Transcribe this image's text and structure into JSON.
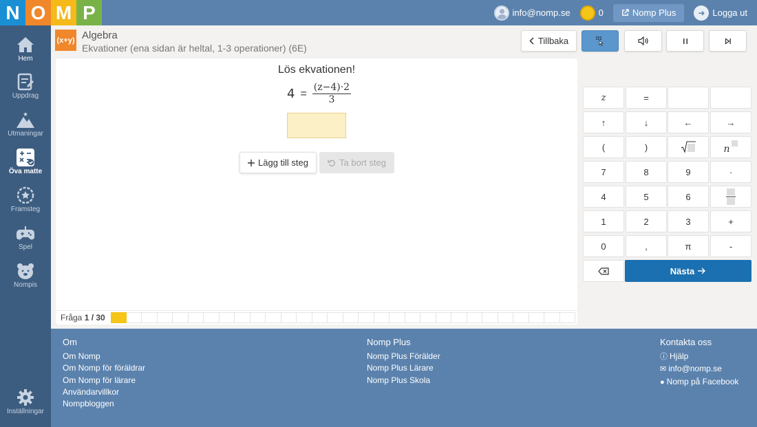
{
  "logo": {
    "letters": [
      "N",
      "O",
      "M",
      "P"
    ],
    "colors": [
      "#1a8fd4",
      "#f0872a",
      "#f5b91a",
      "#79b347"
    ]
  },
  "topbar": {
    "user_email": "info@nomp.se",
    "coins": "0",
    "plus_label": "Nomp Plus",
    "logout_label": "Logga ut"
  },
  "sidebar": {
    "items": [
      {
        "label": "Hem",
        "icon": "home-icon"
      },
      {
        "label": "Uppdrag",
        "icon": "assignment-icon"
      },
      {
        "label": "Utmaningar",
        "icon": "mountain-icon"
      },
      {
        "label": "Öva matte",
        "icon": "calculator-icon"
      },
      {
        "label": "Framsteg",
        "icon": "progress-icon"
      },
      {
        "label": "Spel",
        "icon": "gamepad-icon"
      },
      {
        "label": "Nompis",
        "icon": "bear-icon"
      }
    ],
    "settings_label": "Inställningar"
  },
  "header": {
    "subject_icon": "(x+y)",
    "subject": "Algebra",
    "subtitle": "Ekvationer (ena sidan är heltal, 1-3 operationer) (6E)",
    "back_label": "Tillbaka"
  },
  "question": {
    "instruction": "Lös ekvationen!",
    "lhs": "4",
    "equals": "=",
    "numerator": "(z−4)·2",
    "denominator": "3",
    "add_step_label": "Lägg till steg",
    "remove_step_label": "Ta bort steg"
  },
  "progress": {
    "label": "Fråga",
    "current": "1 / 30",
    "answered": 1,
    "total_cells": 30
  },
  "keypad": {
    "rows": [
      [
        "z",
        "=",
        "",
        ""
      ],
      [
        "↑",
        "↓",
        "←",
        "→"
      ],
      [
        "(",
        ")",
        "√",
        "n"
      ],
      [
        "7",
        "8",
        "9",
        "·"
      ],
      [
        "4",
        "5",
        "6",
        "frac"
      ],
      [
        "1",
        "2",
        "3",
        "+"
      ],
      [
        "0",
        ",",
        "π",
        "-"
      ]
    ],
    "next_label": "Nästa"
  },
  "footer": {
    "col1": {
      "title": "Om",
      "links": [
        "Om Nomp",
        "Om Nomp för föräldrar",
        "Om Nomp för lärare",
        "Användarvillkor",
        "Nompbloggen"
      ]
    },
    "col2": {
      "title": "Nomp Plus",
      "links": [
        "Nomp Plus Förälder",
        "Nomp Plus Lärare",
        "Nomp Plus Skola"
      ]
    },
    "col3": {
      "title": "Kontakta oss",
      "links": [
        "Hjälp",
        "info@nomp.se",
        "Nomp på Facebook"
      ]
    }
  }
}
